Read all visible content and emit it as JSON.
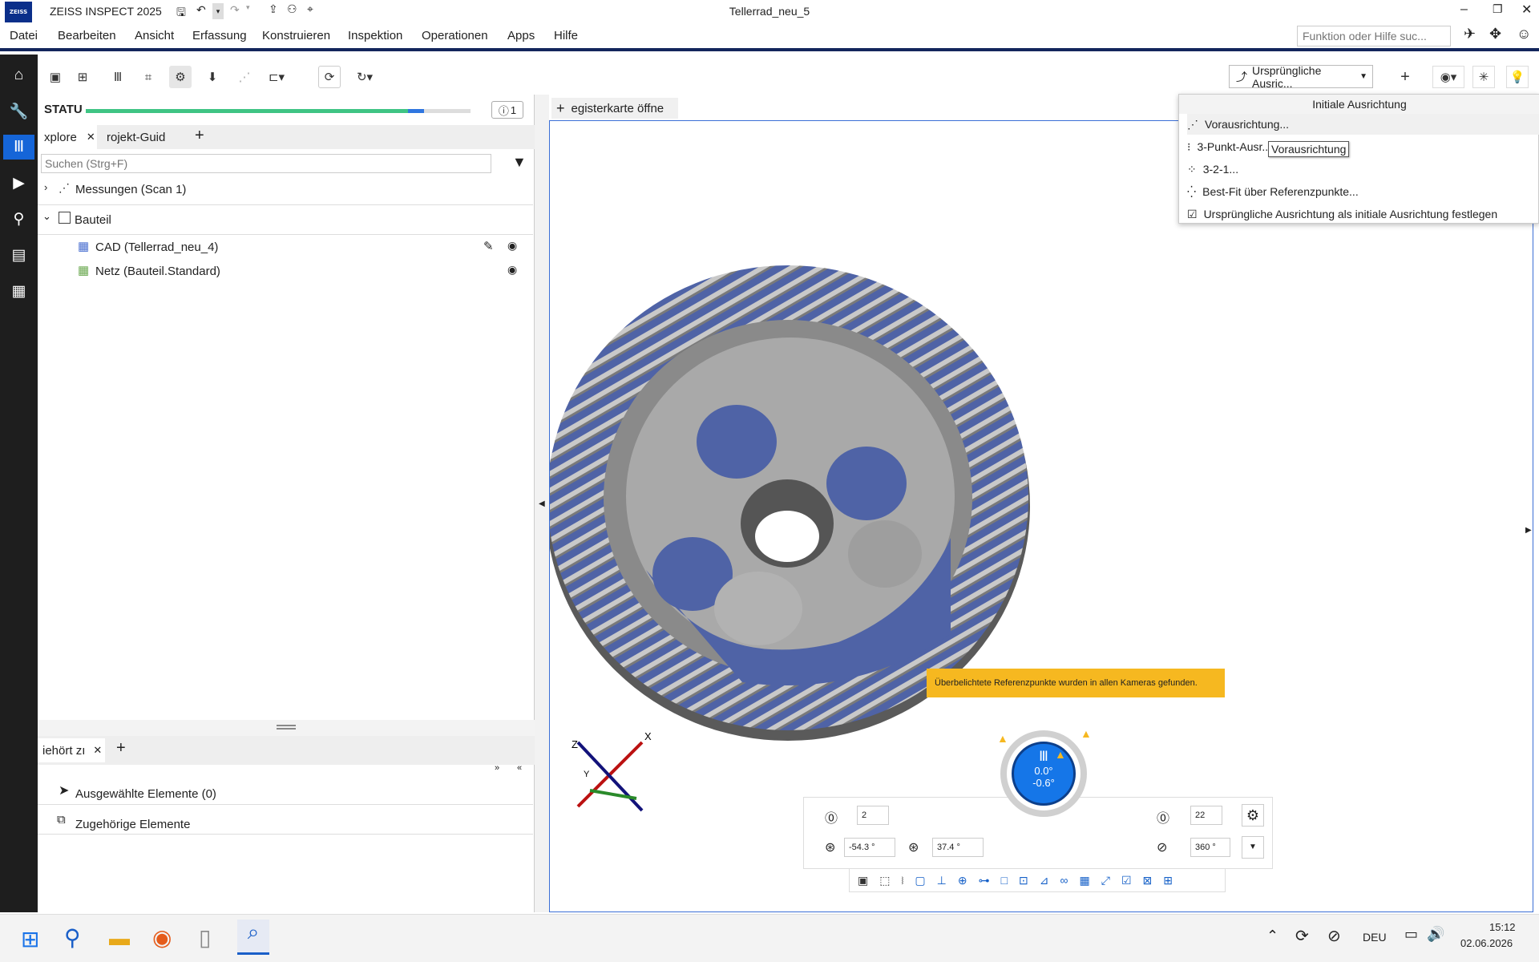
{
  "title_bar": {
    "app_name": "ZEISS INSPECT 2025",
    "document": "Tellerrad_neu_5",
    "logo_text": "ZEISS"
  },
  "menu": [
    "Datei",
    "Bearbeiten",
    "Ansicht",
    "Erfassung",
    "Konstruieren",
    "Inspektion",
    "Operationen",
    "Apps",
    "Hilfe"
  ],
  "search": {
    "placeholder": "Funktion oder Hilfe suc..."
  },
  "toolbar": {
    "alignment_label": "Ursprüngliche Ausric..."
  },
  "status": {
    "label": "STATU",
    "info_count": "1",
    "progress": 0.88
  },
  "panel_tabs": [
    {
      "label": "xplore"
    },
    {
      "label": "rojekt-Guid"
    }
  ],
  "explorer": {
    "search_placeholder": "Suchen (Strg+F)",
    "measurements": "Messungen (Scan 1)",
    "part": "Bauteil",
    "cad": "CAD (Tellerrad_neu_4)",
    "mesh": "Netz (Bauteil.Standard)"
  },
  "lower_panel": {
    "tab": "iehört zı",
    "selected": "Ausgewählte Elemente (0)",
    "related": "Zugehörige Elemente"
  },
  "viewport": {
    "new_tab": "egisterkarte öffne",
    "warning": "Überbelichtete Referenzpunkte wurden in allen Kameras gefunden."
  },
  "dropdown": {
    "header": "Initiale Ausrichtung",
    "items": [
      "Vorausrichtung...",
      "3-Punkt-Ausr...",
      "3-2-1...",
      "Best-Fit über Referenzpunkte...",
      "Ursprüngliche Ausrichtung als initiale Ausrichtung festlegen"
    ],
    "tooltip": "Vorausrichtung"
  },
  "turntable": {
    "angle1": "0.0°",
    "angle2": "-0.6°",
    "left_count": "2",
    "left_angle1": "-54.3 °",
    "left_angle2": "37.4 °",
    "right_count": "22",
    "right_angle": "360 °"
  },
  "axis": {
    "x": "X",
    "y": "Y",
    "z": "Z"
  },
  "taskbar": {
    "lang": "DEU",
    "time": "15:12",
    "date": "02.06.2026"
  },
  "colors": {
    "accent": "#0b2f8a",
    "progress": "#3fc484",
    "warning": "#f6b820",
    "gear_blue": "#4f63a6",
    "gear_gray": "#a9a9a9"
  }
}
